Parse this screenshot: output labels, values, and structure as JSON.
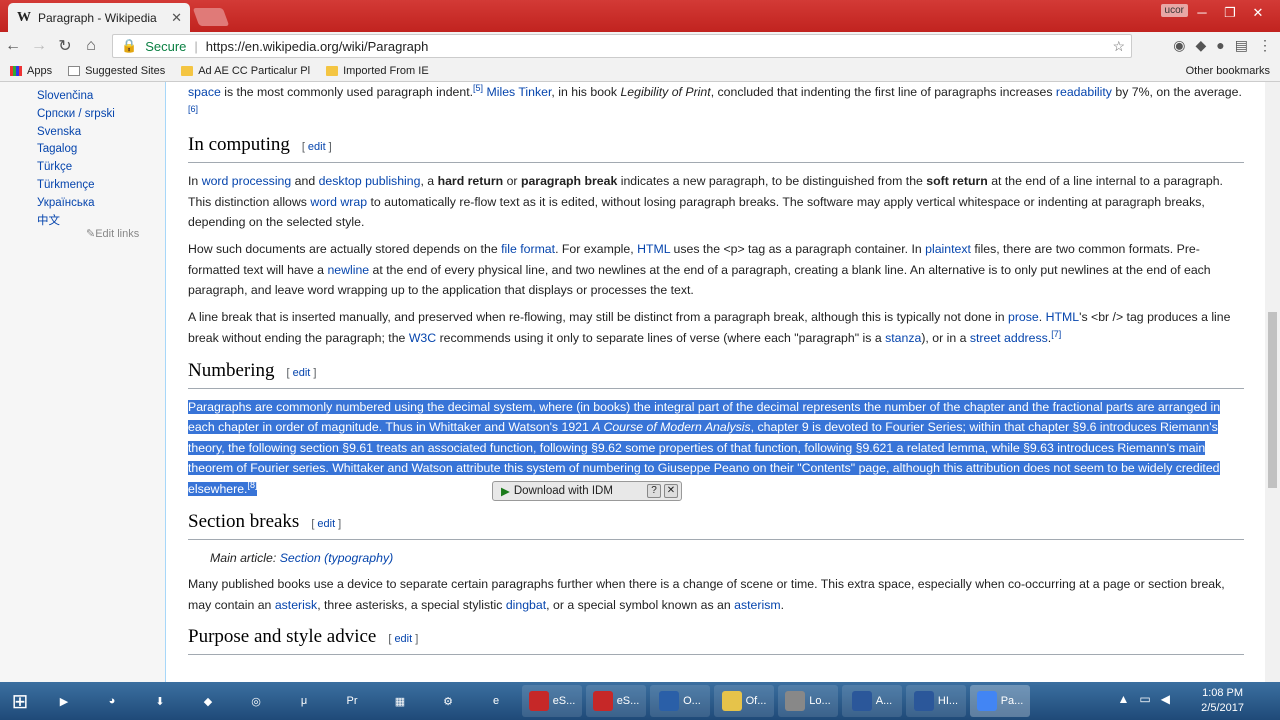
{
  "browser": {
    "tab_title": "Paragraph - Wikipedia",
    "tab_close": "✕",
    "user_badge": "ucor",
    "secure_label": "Secure",
    "url": "https://en.wikipedia.org/wiki/Paragraph",
    "bookmarks": [
      {
        "label": "Apps",
        "icon": "apps-grid-icon"
      },
      {
        "label": "Suggested Sites",
        "icon": "page-icon"
      },
      {
        "label": "Ad AE CC Particalur Pl",
        "icon": "folder-icon"
      },
      {
        "label": "Imported From IE",
        "icon": "folder-icon"
      }
    ],
    "other_bookmarks": "Other bookmarks"
  },
  "sidebar": {
    "languages": [
      "Slovenčina",
      "Српски / srpski",
      "Svenska",
      "Tagalog",
      "Türkçe",
      "Türkmençe",
      "Українська",
      "中文"
    ],
    "edit_links": "✎Edit links"
  },
  "article": {
    "intro_tail": {
      "a": "space",
      "b": " is the most commonly used paragraph indent.",
      "ref5": "[5]",
      "link_tinker": "Miles Tinker",
      "c": ", in his book ",
      "book": "Legibility of Print",
      "d": ", concluded that indenting the first line of paragraphs increases ",
      "link_readability": "readability",
      "e": " by 7%, on the average.",
      "ref6": "[6]"
    },
    "edit_label": "edit",
    "h_computing": "In computing",
    "p1": {
      "t1": "In ",
      "l1": "word processing",
      "t2": " and ",
      "l2": "desktop publishing",
      "t3": ", a ",
      "b1": "hard return",
      "t4": " or ",
      "b2": "paragraph break",
      "t5": " indicates a new paragraph, to be distinguished from the ",
      "b3": "soft return",
      "t6": " at the end of a line internal to a paragraph. This distinction allows ",
      "l3": "word wrap",
      "t7": " to automatically re-flow text as it is edited, without losing paragraph breaks. The software may apply vertical whitespace or indenting at paragraph breaks, depending on the selected style."
    },
    "p2": {
      "t1": "How such documents are actually stored depends on the ",
      "l1": "file format",
      "t2": ". For example, ",
      "l2": "HTML",
      "t3": " uses the <p> tag as a paragraph container. In ",
      "l3": "plaintext",
      "t4": " files, there are two common formats. Pre-formatted text will have a ",
      "l4": "newline",
      "t5": " at the end of every physical line, and two newlines at the end of a paragraph, creating a blank line. An alternative is to only put newlines at the end of each paragraph, and leave word wrapping up to the application that displays or processes the text."
    },
    "p3": {
      "t1": "A line break that is inserted manually, and preserved when re-flowing, may still be distinct from a paragraph break, although this is typically not done in ",
      "l1": "prose",
      "t2": ". ",
      "l2": "HTML",
      "t3": "'s <br /> tag produces a line break without ending the paragraph; the ",
      "l3": "W3C",
      "t4": " recommends using it only to separate lines of verse (where each \"paragraph\" is a ",
      "l4": "stanza",
      "t5": "), or in a ",
      "l5": "street address",
      "t6": ".",
      "ref": "[7]"
    },
    "h_numbering": "Numbering",
    "p4": {
      "t1": "Paragraphs are commonly numbered using the decimal system, where (in books) the integral part of the decimal represents the number of the chapter and the fractional parts are arranged in each chapter in order of magnitude. Thus in Whittaker and Watson's 1921 ",
      "i1": "A Course of Modern Analysis",
      "t2": ", chapter 9 is devoted to Fourier Series; within that chapter §9.6 introduces Riemann's theory, the following section §9.61 treats an associated function, following §9.62 some properties of that function, following §9.621 a related lemma, while §9.63 introduces Riemann's main theorem of Fourier series. Whittaker and Watson attribute this system of numbering to Giuseppe Peano on their \"Contents\" page, although this attribution does not seem to be widely credited elsewhere.",
      "ref": "[8]"
    },
    "h_section": "Section breaks",
    "hatnote": {
      "t1": "Main article: ",
      "l1": "Section (typography)"
    },
    "p5": {
      "t1": "Many published books use a device to separate certain paragraphs further when there is a change of scene or time. This extra space, especially when co-occurring at a page or section break, may contain an ",
      "l1": "asterisk",
      "t2": ", three asterisks, a special stylistic ",
      "l2": "dingbat",
      "t3": ", or a special symbol known as an ",
      "l3": "asterism",
      "t4": "."
    },
    "h_purpose": "Purpose and style advice"
  },
  "idm": {
    "label": "Download with IDM",
    "help": "?",
    "close": "✕"
  },
  "taskbar": {
    "items": [
      {
        "label": "eS...",
        "color": "#c62828"
      },
      {
        "label": "eS...",
        "color": "#c62828"
      },
      {
        "label": "O...",
        "color": "#2a5fa8"
      },
      {
        "label": "Of...",
        "color": "#e6c34a"
      },
      {
        "label": "Lo...",
        "color": "#888888"
      },
      {
        "label": "A...",
        "color": "#2b579a"
      },
      {
        "label": "HI...",
        "color": "#2b579a"
      },
      {
        "label": "Pa...",
        "color": "#4285f4"
      }
    ],
    "time": "1:08 PM",
    "date": "2/5/2017"
  }
}
